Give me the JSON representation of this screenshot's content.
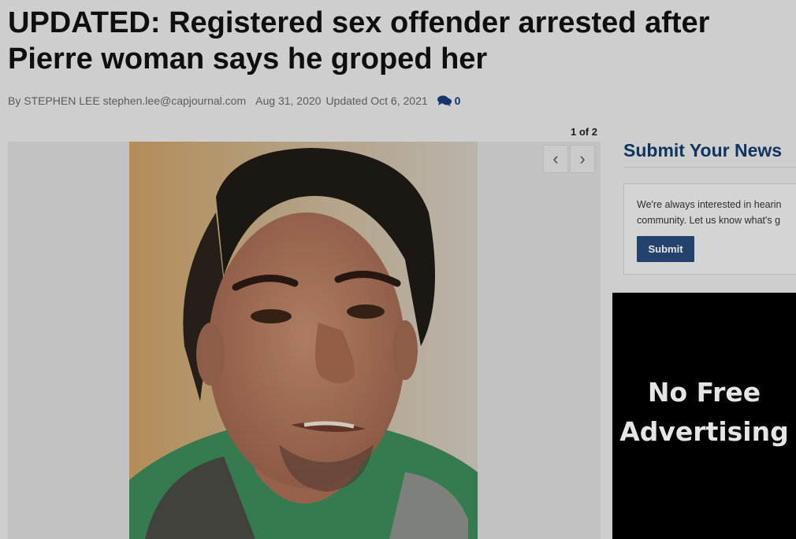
{
  "article": {
    "headline_line1": "UPDATED: Registered sex offender arrested after",
    "headline_line2": "Pierre woman says he groped her",
    "byline": {
      "prefix": "By STEPHEN LEE stephen.lee@capjournal.com",
      "published": "Aug 31, 2020",
      "updated": "Updated Oct 6, 2021",
      "comment_count": "0",
      "comment_icon": "comments-icon"
    }
  },
  "gallery": {
    "counter": "1 of 2",
    "prev_icon": "chevron-left-icon",
    "next_icon": "chevron-right-icon",
    "prev_glyph": "‹",
    "next_glyph": "›"
  },
  "sidebar": {
    "title": "Submit Your News",
    "text_line1": "We're always interested in hearin",
    "text_line2": "community. Let us know what's g",
    "submit_label": "Submit"
  },
  "ad": {
    "line1": "No Free",
    "line2": "Advertising"
  },
  "colors": {
    "accent": "#123a6b",
    "button": "#2a4a7a",
    "comments": "#1a3a7a"
  }
}
